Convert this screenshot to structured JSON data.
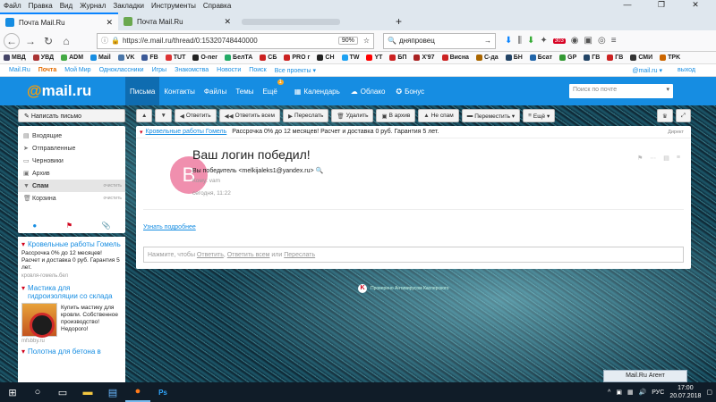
{
  "browser": {
    "menu": [
      "Файл",
      "Правка",
      "Вид",
      "Журнал",
      "Закладки",
      "Инструменты",
      "Справка"
    ],
    "tabs": [
      {
        "title": "Почта Mail.Ru",
        "active": true
      },
      {
        "title": "Почта Mail.Ru",
        "active": false
      }
    ],
    "url": "https://e.mail.ru/thread/0:15320748440000",
    "zoom": "90%",
    "search_query": "дняпровец",
    "badge_count": "303",
    "bookmarks": [
      "МВД",
      "УВД",
      "ADM",
      "Mail",
      "VK",
      "FB",
      "TUT",
      "O-ner",
      "БелТА",
      "СБ",
      "PRO г",
      "CH",
      "TW",
      "YT",
      "БП",
      "X'97",
      "Висна",
      "С-да",
      "БН",
      "Бсат",
      "GP",
      "ГВ",
      "ГВ",
      "СМИ",
      "TPK"
    ]
  },
  "portal": {
    "links": [
      "Mail.Ru",
      "Почта",
      "Мой Мир",
      "Одноклассники",
      "Игры",
      "Знакомства",
      "Новости",
      "Поиск",
      "Все проекты ▾"
    ],
    "active": "Почта",
    "account": "@mail.ru ▾",
    "logout": "выход"
  },
  "header": {
    "logo_at": "@",
    "logo_text": "mail.ru",
    "tabs": [
      "Письма",
      "Контакты",
      "Файлы",
      "Темы",
      "Ещё"
    ],
    "more_badge": "1",
    "tools": [
      "Календарь",
      "Облако",
      "Бонус"
    ],
    "search_placeholder": "Поиск по почте"
  },
  "sidebar": {
    "compose": "Написать письмо",
    "folders": [
      {
        "icon": "inbox-icon",
        "label": "Входящие",
        "clear": ""
      },
      {
        "icon": "sent-icon",
        "label": "Отправленные",
        "clear": ""
      },
      {
        "icon": "drafts-icon",
        "label": "Черновики",
        "clear": ""
      },
      {
        "icon": "archive-icon",
        "label": "Архив",
        "clear": ""
      },
      {
        "icon": "spam-icon",
        "label": "Спам",
        "clear": "очистить"
      },
      {
        "icon": "trash-icon",
        "label": "Корзина",
        "clear": "очистить"
      }
    ]
  },
  "ads": [
    {
      "title": "Кровельные работы Гомель",
      "text": "Рассрочка 0% до 12 месяцев! Расчет и доставка 0 руб. Гарантия 5 лет.",
      "url": "кровля-гомель.бел"
    },
    {
      "title": "Мастика для гидроизоляции со склада",
      "text": "Купить мастику для кровли. Собственное производство! Недорого!",
      "url": "mfsbby.ru"
    },
    {
      "title": "Полотна для бетона в",
      "text": "",
      "url": ""
    }
  ],
  "toolbar": [
    "Ответить",
    "Ответить всем",
    "Переслать",
    "Удалить",
    "В архив",
    "Не спам",
    "Переместить ▾",
    "Ещё ▾"
  ],
  "message": {
    "ad_title": "Кровельные работы Гомель",
    "ad_text": "Рассрочка 0% до 12 месяцев! Расчет и доставка 0 руб. Гарантия 5 лет.",
    "ad_label": "Директ",
    "avatar_letter": "В",
    "subject": "Ваш логин победил!",
    "from": "Вы победитель <melkijaleks1@yandex.ru>",
    "to": "Кому: vam",
    "date": "сегодня, 11:22",
    "more_link": "Узнать подробнее",
    "reply_prefix": "Нажмите, чтобы ",
    "reply_1": "Ответить",
    "reply_2": "Ответить всем",
    "reply_or": " или ",
    "reply_3": "Переслать"
  },
  "kaspersky": "Проверено Антивирусом Касперского",
  "agent": "Mail.Ru Агент",
  "taskbar": {
    "lang": "РУС",
    "time": "17:00",
    "date": "20.07.2018"
  }
}
